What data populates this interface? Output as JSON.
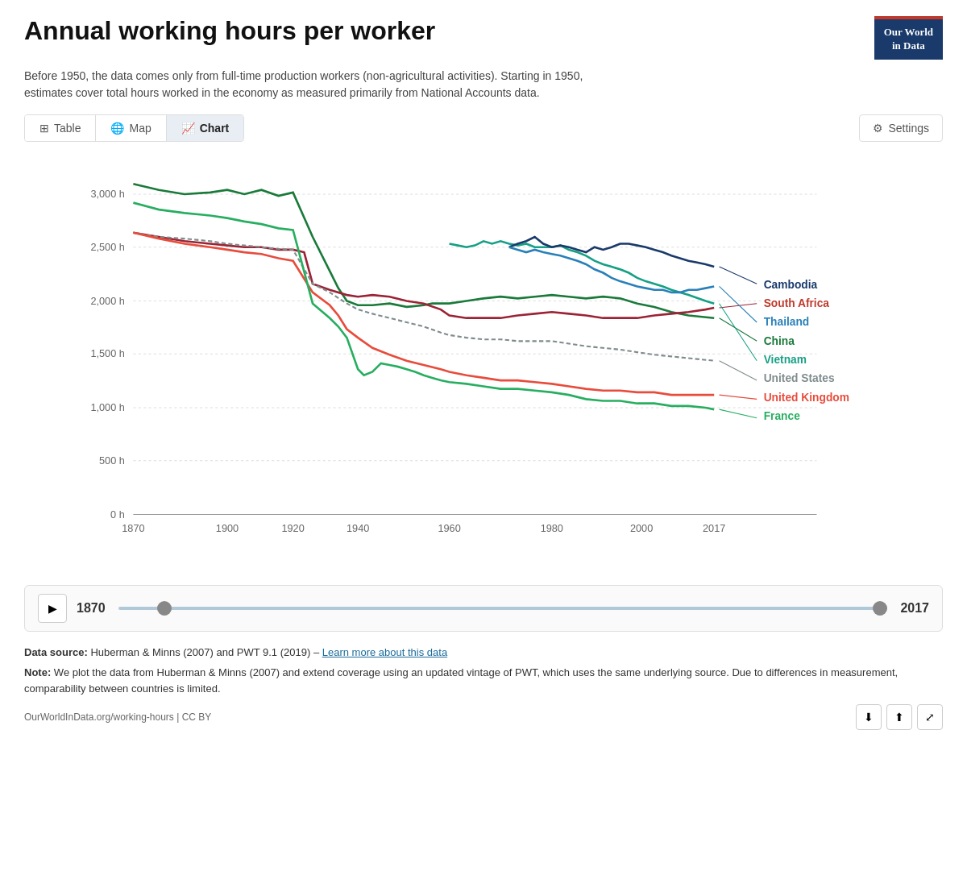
{
  "header": {
    "title": "Annual working hours per worker",
    "subtitle": "Before 1950, the data comes only from full-time production workers (non-agricultural activities). Starting in 1950, estimates cover total hours worked in the economy as measured primarily from National Accounts data.",
    "logo_line1": "Our World",
    "logo_line2": "in Data"
  },
  "tabs": {
    "table_label": "Table",
    "map_label": "Map",
    "chart_label": "Chart",
    "settings_label": "Settings"
  },
  "chart": {
    "y_axis": [
      "3,000 h",
      "2,500 h",
      "2,000 h",
      "1,500 h",
      "1,000 h",
      "500 h",
      "0 h"
    ],
    "x_axis": [
      "1870",
      "1900",
      "1920",
      "1940",
      "1960",
      "1980",
      "2000",
      "2017"
    ]
  },
  "legend": {
    "items": [
      {
        "label": "Cambodia",
        "color": "#1a3a6b"
      },
      {
        "label": "South Africa",
        "color": "#c0392b"
      },
      {
        "label": "Thailand",
        "color": "#2980b9"
      },
      {
        "label": "China",
        "color": "#27ae60"
      },
      {
        "label": "Vietnam",
        "color": "#16a085"
      },
      {
        "label": "United States",
        "color": "#7f8c8d"
      },
      {
        "label": "United Kingdom",
        "color": "#e74c3c"
      },
      {
        "label": "France",
        "color": "#2ecc71"
      }
    ]
  },
  "playback": {
    "play_icon": "▶",
    "start_year": "1870",
    "end_year": "2017"
  },
  "footer": {
    "source_label": "Data source:",
    "source_text": "Huberman & Minns (2007) and PWT 9.1 (2019) –",
    "source_link": "Learn more about this data",
    "note_label": "Note:",
    "note_text": "We plot the data from Huberman & Minns (2007) and extend coverage using an updated vintage of PWT, which uses the same underlying source. Due to differences in measurement, comparability between countries is limited.",
    "url": "OurWorldInData.org/working-hours | CC BY",
    "download_icon": "⬇",
    "share_icon": "⬆",
    "fullscreen_icon": "⤢"
  }
}
